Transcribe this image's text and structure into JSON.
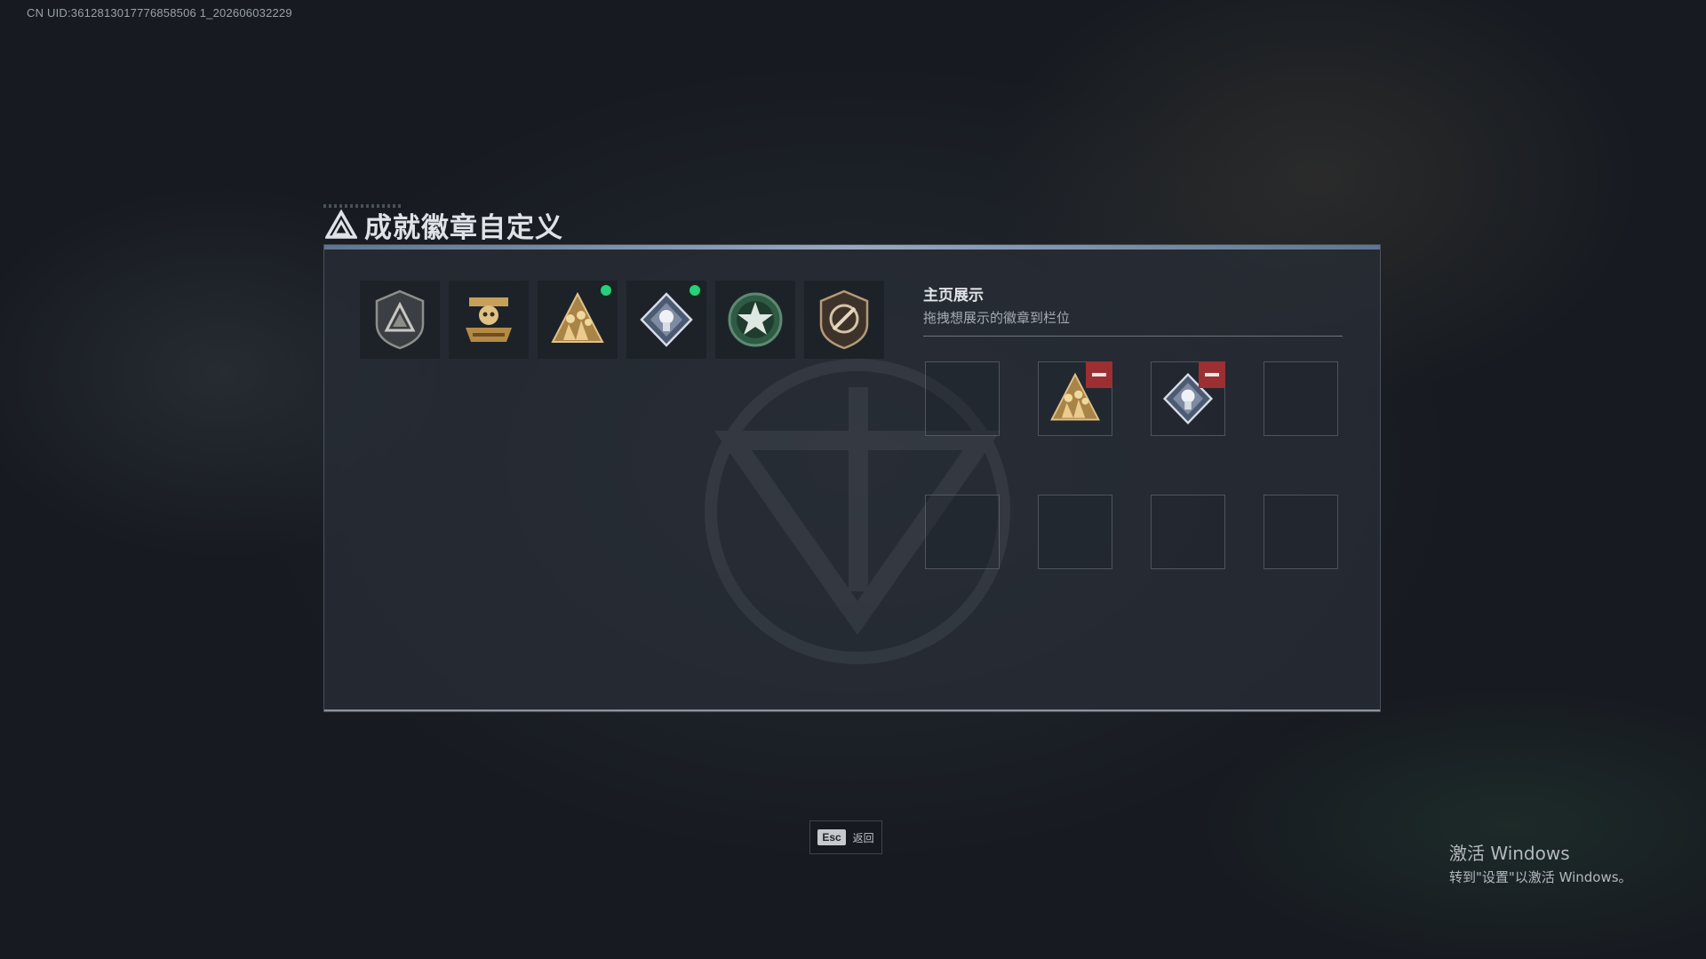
{
  "overlay": {
    "uid": "CN UID:3612813017776858506 1_202606032229"
  },
  "header": {
    "title": "成就徽章自定义",
    "icon": "triangle-logo-icon"
  },
  "badges": [
    {
      "name": "shield-triangle-badge",
      "new": false
    },
    {
      "name": "golden-skull-tank-badge",
      "new": false
    },
    {
      "name": "golden-triangle-soldiers-badge",
      "new": true
    },
    {
      "name": "silver-diamond-crest-badge",
      "new": true
    },
    {
      "name": "green-star-wreath-badge",
      "new": false
    },
    {
      "name": "bronze-shield-compass-badge",
      "new": false
    }
  ],
  "display": {
    "title": "主页展示",
    "subtitle": "拖拽想展示的徽章到栏位",
    "slots": [
      {
        "badge": ""
      },
      {
        "badge": "golden-triangle-soldiers-badge"
      },
      {
        "badge": "silver-diamond-crest-badge"
      },
      {
        "badge": ""
      },
      {
        "badge": ""
      },
      {
        "badge": ""
      },
      {
        "badge": ""
      },
      {
        "badge": ""
      }
    ]
  },
  "footer": {
    "esc_key": "Esc",
    "esc_label": "返回"
  },
  "windows_activation": {
    "line1": "激活 Windows",
    "line2": "转到\"设置\"以激活 Windows。"
  },
  "colors": {
    "accent_new": "#27d07a",
    "remove": "#9b2f32",
    "panel_bar": "#98a9bf"
  }
}
